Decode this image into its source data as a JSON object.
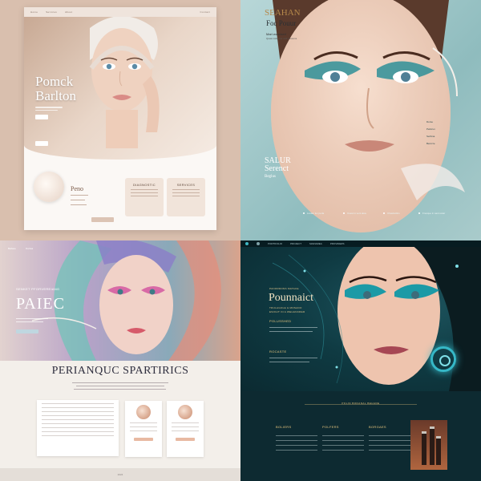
{
  "q1": {
    "nav": [
      "Home",
      "Services",
      "About"
    ],
    "nav_right": "Contact",
    "brand": [
      "Pomck",
      "Barlton"
    ],
    "card_title": "Peno",
    "box1": "DIAGNOSTIC",
    "box2": "SERVICES"
  },
  "q2": {
    "title1": "SEAHAN",
    "title2": "Foc Pouur",
    "tag1": "Mari woodserf",
    "tag2": "Quasi caberner and cascons",
    "script1": [
      "SALUR",
      "Serenct",
      "Beglus"
    ],
    "menu": [
      "Dorse",
      "Peilcrun",
      "Serbina",
      "Benrcre"
    ],
    "bullets": [
      "Lustan lux perla",
      "Cuesi in veni aloa",
      "Chasbotlins",
      "Fresque in sant ostar"
    ]
  },
  "q3": {
    "nav": [
      "Beilace",
      "Ovclea"
    ],
    "pre": "SENKET PFORVEREIANG",
    "title": "PAIEC",
    "heading": "PERIANQUC SPARTIRICS",
    "footer": "2024"
  },
  "q4": {
    "nav": [
      "PORTIFOLIO",
      "PROJECT",
      "MAINAREA",
      "PROVIDERS"
    ],
    "pre": "PANORDONS MATACE",
    "title": "Pounnaict",
    "sub1": "TRULAGOLE & MOSADO",
    "sub2": "ESOGIT IN A WEHANCRER",
    "label1": "POLUSSHED",
    "label2": "ROCASTE",
    "section": "POLIN BODANAL BEHADE",
    "cols": [
      "BOLIERS",
      "POLFERS",
      "BORGAES"
    ]
  },
  "colors": {
    "q1_accent": "#c8a994",
    "q2_accent": "#8fbcbe",
    "q3_accent": "#b7a2c8",
    "q4_accent": "#36b8c7",
    "q4_gold": "#e7c57d"
  }
}
